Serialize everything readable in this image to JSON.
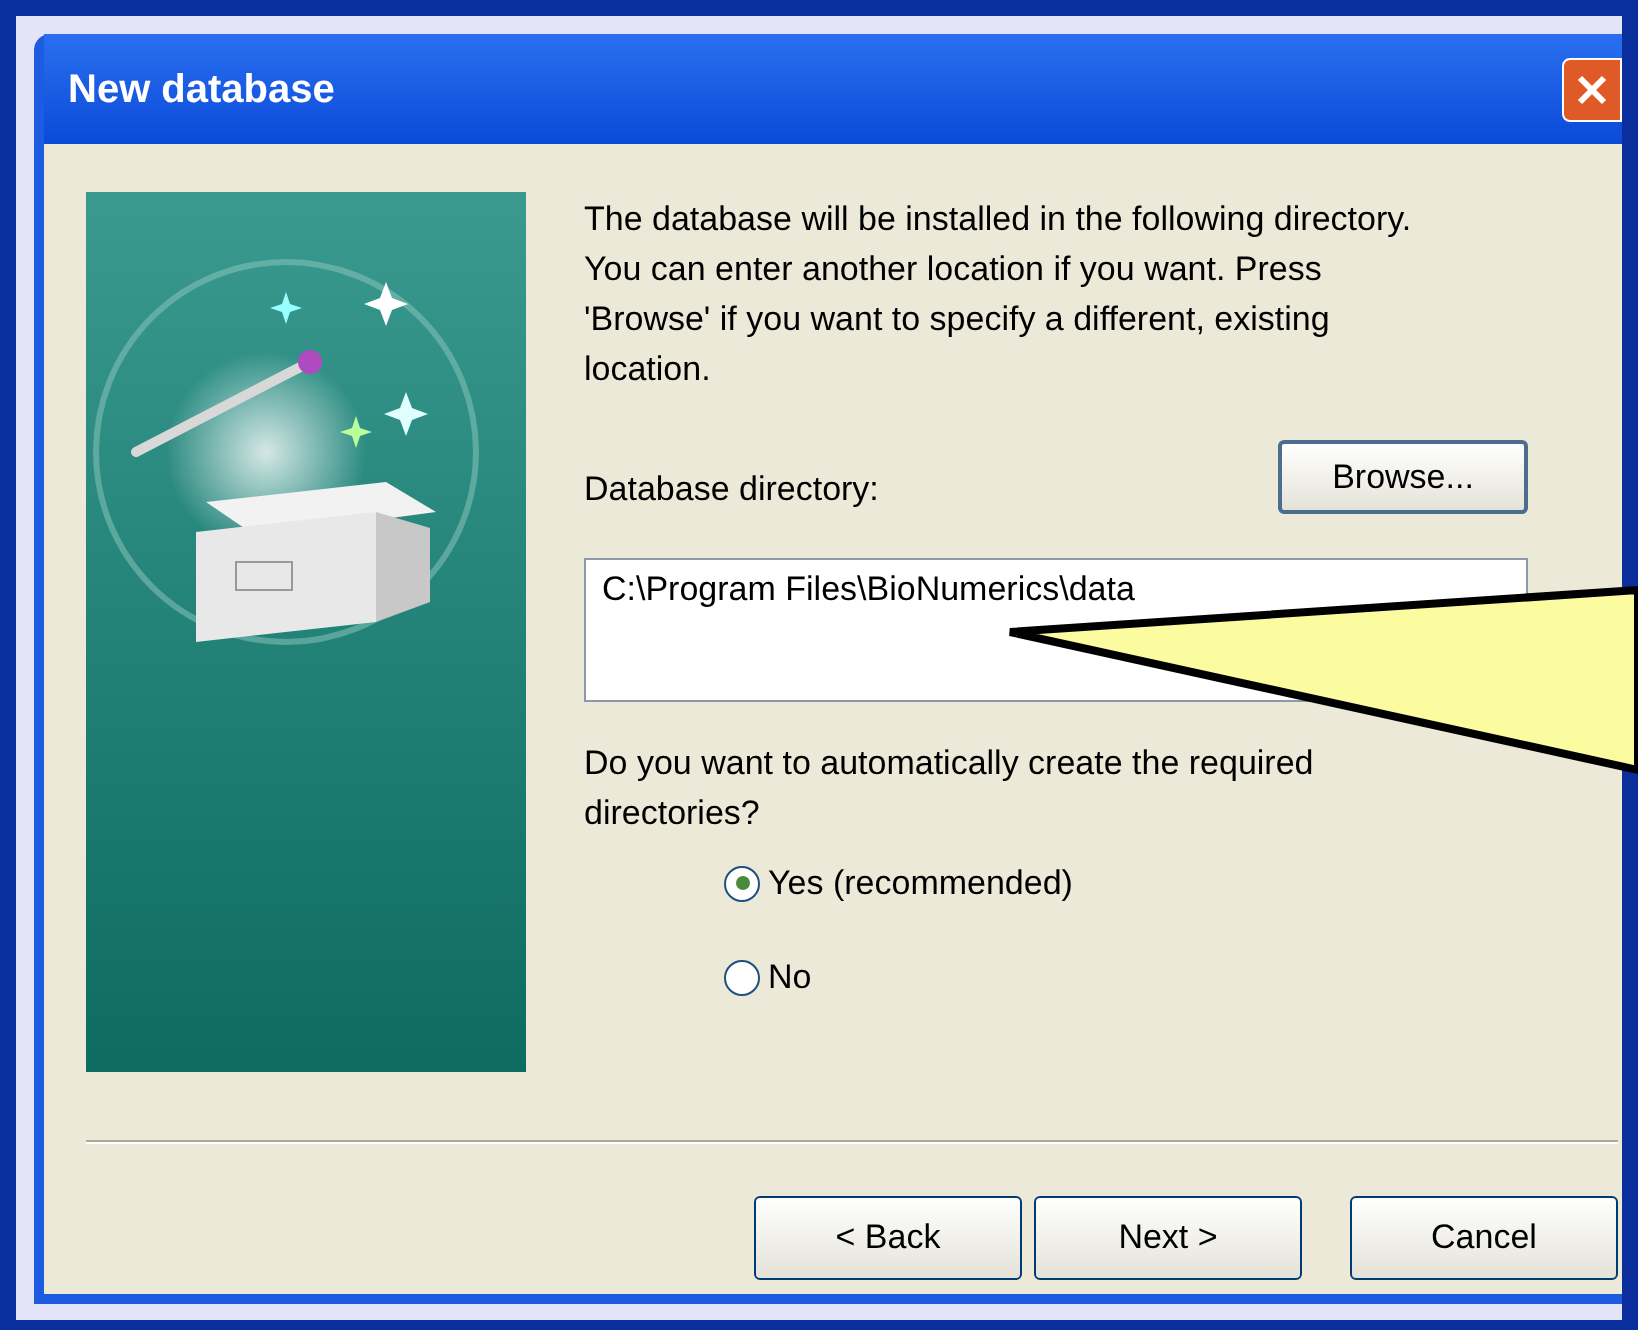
{
  "window": {
    "title": "New database"
  },
  "intro": "The database will be installed in the following directory. You can enter another location if you want. Press 'Browse' if you want to specify a different, existing location.",
  "directory": {
    "label": "Database directory:",
    "browse": "Browse...",
    "value": "C:\\Program Files\\BioNumerics\\data"
  },
  "question": "Do you want to automatically create the required directories?",
  "options": [
    {
      "label": "Yes (recommended)",
      "selected": true
    },
    {
      "label": "No",
      "selected": false
    }
  ],
  "buttons": [
    "< Back",
    "Next >",
    "Cancel"
  ]
}
